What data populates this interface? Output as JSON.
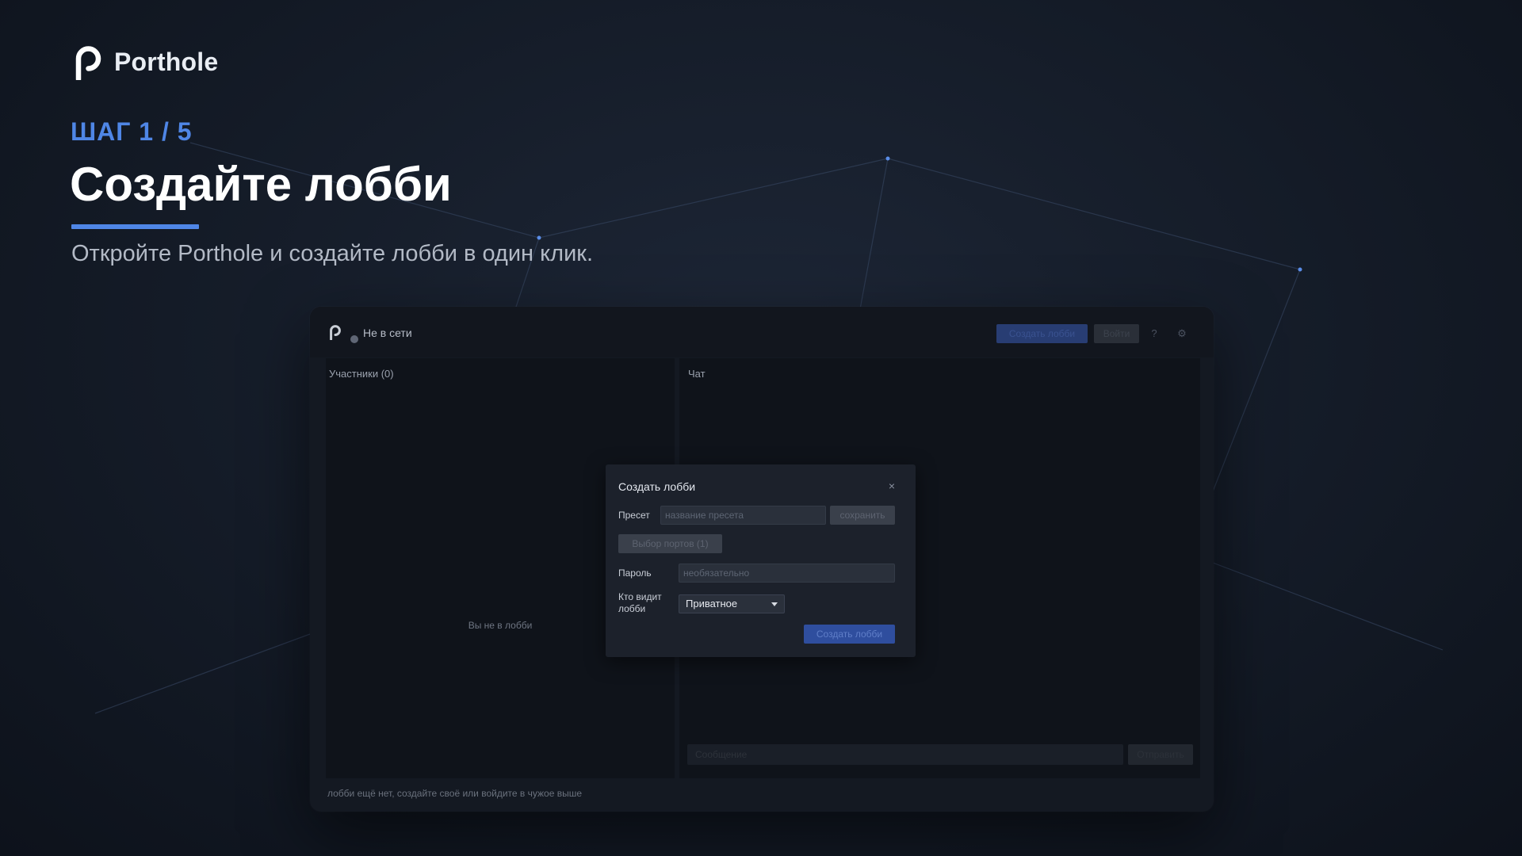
{
  "brand": {
    "name": "Porthole"
  },
  "hero": {
    "step": "ШАГ 1 / 5",
    "title": "Создайте лобби",
    "subtitle": "Откройте Porthole и создайте лобби в один клик."
  },
  "app": {
    "status": "Не в сети",
    "toolbar": {
      "create_label": "Создать лобби",
      "join_label": "Войти",
      "help_icon": "?",
      "settings_icon": "⚙"
    },
    "participants": {
      "title": "Участники (0)",
      "empty": "Вы не в лобби"
    },
    "chat": {
      "title": "Чат",
      "input_placeholder": "Сообщение",
      "send_label": "Отправить"
    },
    "bottom_hint": "лобби ещё нет, создайте своё или войдите в чужое выше"
  },
  "modal": {
    "title": "Создать лобби",
    "close": "×",
    "preset_label": "Пресет",
    "preset_placeholder": "название пресета",
    "preset_save": "сохранить",
    "ports_button": "Выбор портов (1)",
    "password_label": "Пароль",
    "password_placeholder": "необязательно",
    "visibility_label_line1": "Кто видит",
    "visibility_label_line2": "лобби",
    "visibility_value": "Приватное",
    "submit": "Создать лобби"
  },
  "colors": {
    "accent": "#4f86e6",
    "background": "#141b27"
  }
}
